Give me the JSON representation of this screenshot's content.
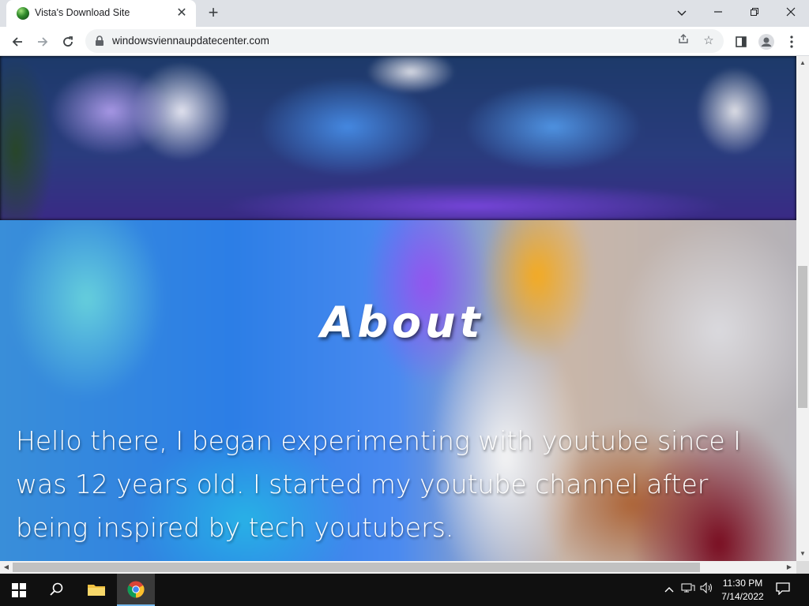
{
  "browser": {
    "tab_title": "Vista's Download Site",
    "url": "windowsviennaupdatecenter.com"
  },
  "page": {
    "about_heading": "About",
    "about_paragraph": "Hello there, I began experimenting with youtube since I was 12 years old. I started my youtube channel after being inspired by tech youtubers."
  },
  "taskbar": {
    "time": "11:30 PM",
    "date": "7/14/2022",
    "pinned": [
      "start-icon",
      "search-icon",
      "file-explorer-icon",
      "chrome-icon"
    ]
  },
  "colors": {
    "tabstrip": "#dee1e6",
    "taskbar": "#101010",
    "active_taskbar_accent": "#76b9ed"
  }
}
